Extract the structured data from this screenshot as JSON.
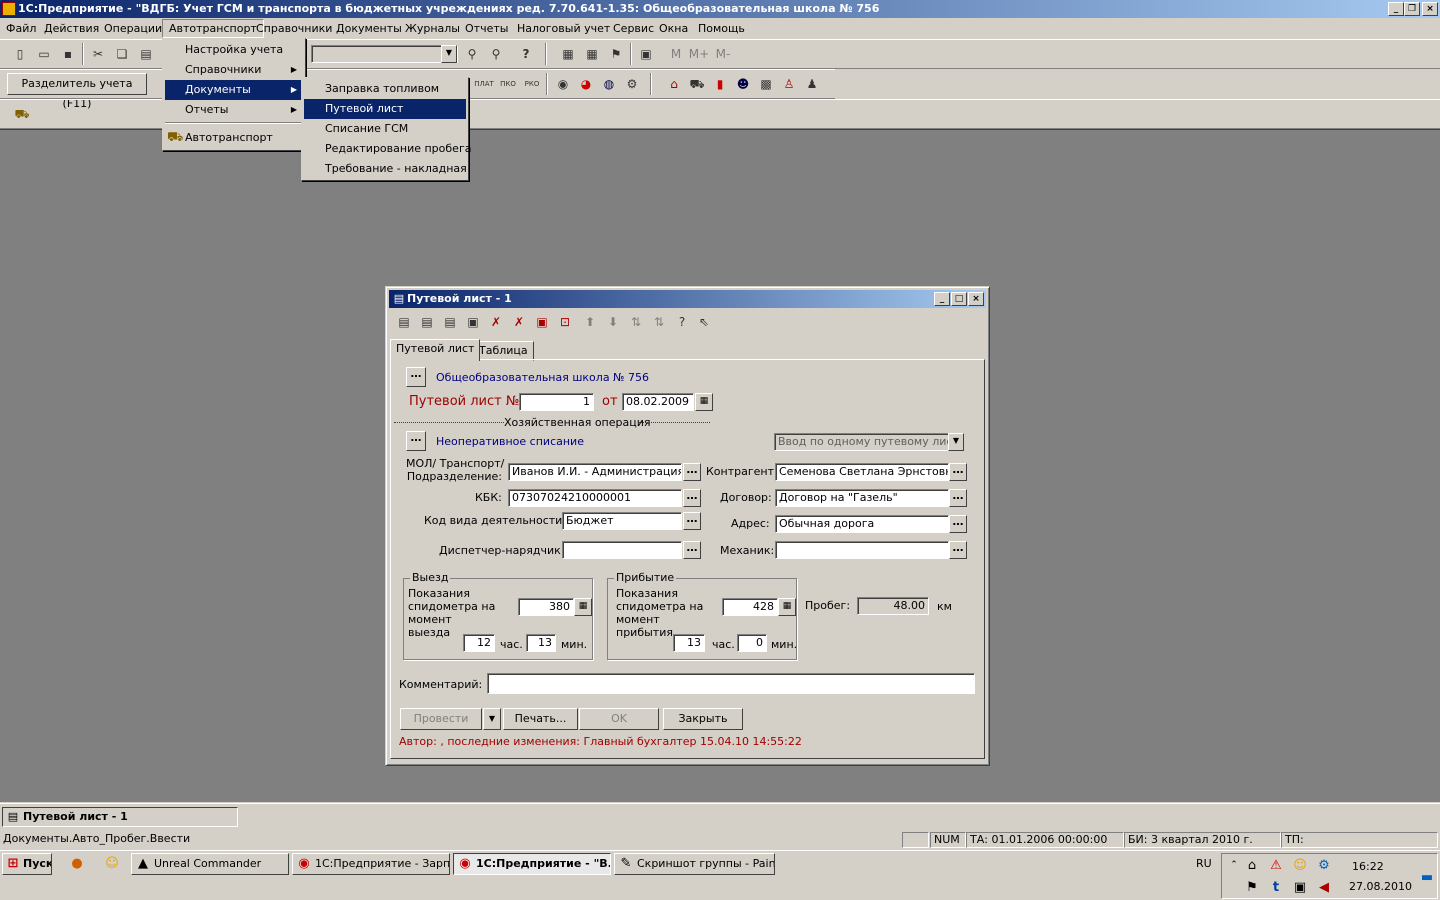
{
  "app": {
    "title": "1С:Предприятие - \"ВДГБ: Учет ГСМ и транспорта в бюджетных учреждениях ред. 7.70.641-1.35:  Общеобразовательная школа № 756",
    "window_buttons": [
      "_",
      "▫",
      "×"
    ]
  },
  "menubar": {
    "items": [
      "Файл",
      "Действия",
      "Операции",
      "Автотранспорт",
      "Справочники",
      "Документы",
      "Журналы",
      "Отчеты",
      "Налоговый учет",
      "Сервис",
      "Окна",
      "Помощь"
    ]
  },
  "toolbar": {
    "separator_label": "Разделитель учета (F11)",
    "memory_buttons": [
      "M",
      "M+",
      "M-"
    ],
    "doc_buttons": [
      "ПЛАТ",
      "ПКО",
      "РКО"
    ]
  },
  "menu_autotransport": {
    "items": [
      "Настройка учета",
      "Справочники",
      "Документы",
      "Отчеты"
    ],
    "extra_item": "Автотранспорт"
  },
  "submenu_documents": {
    "items": [
      "Заправка топливом",
      "Путевой лист",
      "Списание ГСМ",
      "Редактирование пробега",
      "Требование - накладная"
    ]
  },
  "doc_window": {
    "title": "Путевой лист - 1",
    "tabs": [
      "Путевой лист",
      "Таблица"
    ],
    "organization": "Общеобразовательная школа № 756",
    "doc_label": "Путевой лист №",
    "doc_number": "1",
    "date_label": "от",
    "date": "08.02.2009",
    "operation_header": "Хозяйственная операция",
    "operation": "Неоперативное списание",
    "input_mode": "Ввод по одному путевому листу",
    "mol_label_1": "МОЛ/ Транспорт/",
    "mol_label_2": "Подразделение:",
    "mol_value": "Иванов И.И. - Администрация - Газель",
    "kbk_label": "КБК:",
    "kbk_value": "07307024210000001",
    "activity_label": "Код вида деятельности:",
    "activity_value": "Бюджет",
    "dispatcher_label": "Диспетчер-нарядчик:",
    "dispatcher_value": "",
    "contractor_label": "Контрагент:",
    "contractor_value": "Семенова Светлана Эрнстовна",
    "contract_label": "Договор:",
    "contract_value": "Договор на \"Газель\"",
    "address_label": "Адрес:",
    "address_value": "Обычная дорога",
    "mechanic_label": "Механик:",
    "mechanic_value": "",
    "departure": {
      "title": "Выезд",
      "label": "Показания спидометра на момент выезда",
      "odometer": "380",
      "hours": "12",
      "hours_unit": "час.",
      "minutes": "13",
      "minutes_unit": "мин."
    },
    "arrival": {
      "title": "Прибытие",
      "label": "Показания спидометра на момент прибытия",
      "odometer": "428",
      "hours": "13",
      "hours_unit": "час.",
      "minutes": "0",
      "minutes_unit": "мин."
    },
    "mileage_label": "Пробег:",
    "mileage_value": "48.00",
    "mileage_unit": "км",
    "comment_label": "Комментарий:",
    "comment_value": "",
    "buttons": {
      "post": "Провести",
      "print": "Печать...",
      "ok": "OK",
      "close": "Закрыть"
    },
    "author_line": "Автор: , последние изменения: Главный бухгалтер 15.04.10 14:55:22"
  },
  "mdi_tab": "Путевой лист - 1",
  "statusbar": {
    "text": "Документы.Авто_Пробег.Ввести",
    "num": "NUM",
    "ta": "ТА: 01.01.2006  00:00:00",
    "bi": "БИ: 3 квартал 2010 г.",
    "tp": "ТП:"
  },
  "taskbar": {
    "start": "Пуск",
    "tasks": [
      "Unreal Commander",
      "1С:Предприятие - Зарп...",
      "1С:Предприятие - \"В...",
      "Скриншот группы - Paint"
    ],
    "lang": "RU",
    "time": "16:22",
    "date": "27.08.2010"
  },
  "colors": {
    "title_active": "#0a246a",
    "face": "#d4d0c8",
    "mdi_bg": "#808080",
    "doc_label_red": "#a00000",
    "link_blue": "#000080",
    "author_red": "#a00000"
  }
}
